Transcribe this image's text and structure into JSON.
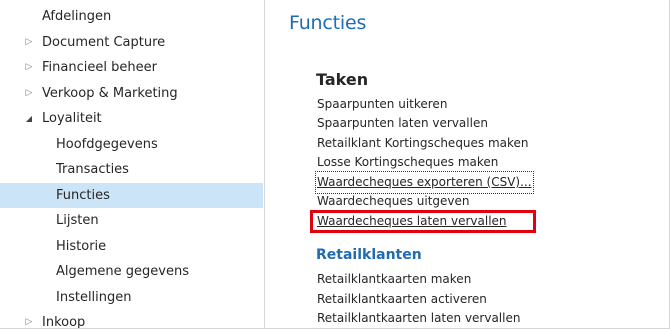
{
  "sidebar": {
    "items": [
      {
        "label": "Afdelingen"
      },
      {
        "label": "Document Capture",
        "icon": "chevron-right-icon",
        "glyph": "▷"
      },
      {
        "label": "Financieel beheer",
        "icon": "chevron-right-icon",
        "glyph": "▷"
      },
      {
        "label": "Verkoop & Marketing",
        "icon": "chevron-right-icon",
        "glyph": "▷"
      },
      {
        "label": "Loyaliteit",
        "icon": "caret-down-icon",
        "glyph": "◢"
      },
      {
        "label": "Hoofdgegevens"
      },
      {
        "label": "Transacties"
      },
      {
        "label": "Functies",
        "selected": true
      },
      {
        "label": "Lijsten"
      },
      {
        "label": "Historie"
      },
      {
        "label": "Algemene gegevens"
      },
      {
        "label": "Instellingen"
      },
      {
        "label": "Inkoop",
        "icon": "chevron-right-icon",
        "glyph": "▷"
      }
    ]
  },
  "main": {
    "title": "Functies",
    "sections": {
      "taken": {
        "heading": "Taken",
        "actions": [
          "Spaarpunten uitkeren",
          "Spaarpunten laten vervallen",
          "Retailklant Kortingscheques maken",
          "Losse Kortingscheques maken",
          "Waardecheques exporteren (CSV)...",
          "Waardecheques uitgeven",
          "Waardecheques laten vervallen"
        ]
      },
      "retailklanten": {
        "heading": "Retailklanten",
        "actions": [
          "Retailklantkaarten maken",
          "Retailklantkaarten activeren",
          "Retailklantkaarten laten vervallen"
        ]
      }
    }
  },
  "colors": {
    "accent_blue": "#1f6bb4",
    "selected_bg": "#cce4f7",
    "highlight_red": "#e0000f"
  }
}
